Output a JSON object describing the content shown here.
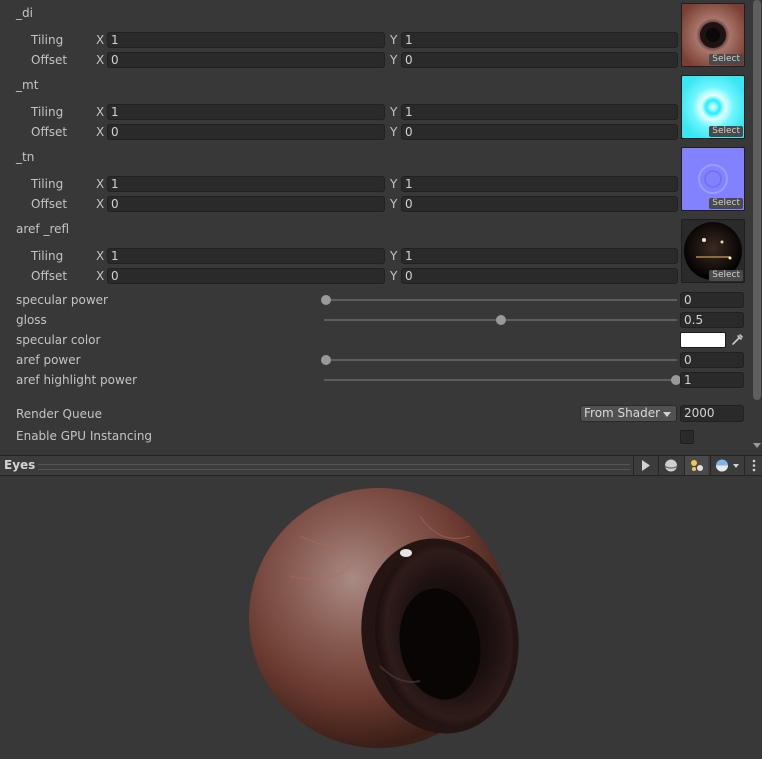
{
  "textures": [
    {
      "name": "_di",
      "tiling_x": "1",
      "tiling_y": "1",
      "offset_x": "0",
      "offset_y": "0",
      "select_label": "Select",
      "thumb": "eye-diffuse"
    },
    {
      "name": "_mt",
      "tiling_x": "1",
      "tiling_y": "1",
      "offset_x": "0",
      "offset_y": "0",
      "select_label": "Select",
      "thumb": "cyan-glow"
    },
    {
      "name": "_tn",
      "tiling_x": "1",
      "tiling_y": "1",
      "offset_x": "0",
      "offset_y": "0",
      "select_label": "Select",
      "thumb": "normal-map"
    },
    {
      "name": "aref _refl",
      "tiling_x": "1",
      "tiling_y": "1",
      "offset_x": "0",
      "offset_y": "0",
      "select_label": "Select",
      "thumb": "reflection-sphere"
    }
  ],
  "labels": {
    "tiling": "Tiling",
    "offset": "Offset",
    "x": "X",
    "y": "Y"
  },
  "properties": {
    "specular_power": {
      "label": "specular power",
      "value": "0",
      "level": 0
    },
    "gloss": {
      "label": "gloss",
      "value": "0.5",
      "level": 0.5
    },
    "specular_color": {
      "label": "specular color",
      "color": "#ffffff"
    },
    "aref_power": {
      "label": "aref power",
      "value": "0",
      "level": 0
    },
    "aref_highlight_power": {
      "label": "aref highlight power",
      "value": "1",
      "level": 1
    }
  },
  "render_queue": {
    "label": "Render Queue",
    "mode": "From Shader",
    "value": "2000"
  },
  "gpu_instancing": {
    "label": "Enable GPU Instancing",
    "checked": false
  },
  "preview": {
    "title": "Eyes"
  },
  "colors": {
    "panel": "#383838",
    "field": "#2a2a2a",
    "accent_cyan": "#3ff0ff",
    "normal_blue": "#8080ff"
  }
}
